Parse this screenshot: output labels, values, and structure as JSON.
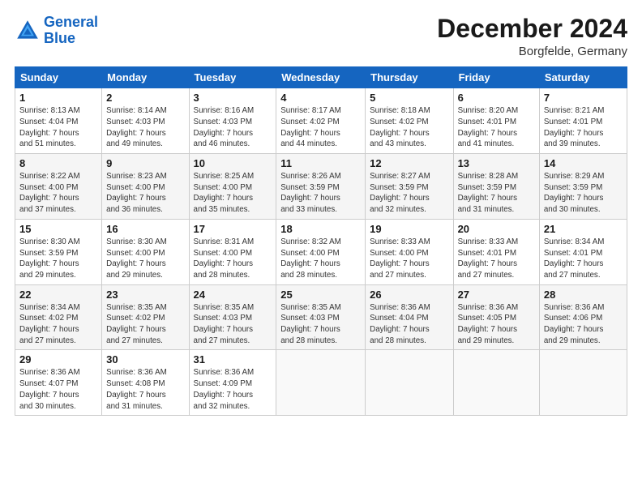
{
  "header": {
    "logo_line1": "General",
    "logo_line2": "Blue",
    "month": "December 2024",
    "location": "Borgfelde, Germany"
  },
  "days_of_week": [
    "Sunday",
    "Monday",
    "Tuesday",
    "Wednesday",
    "Thursday",
    "Friday",
    "Saturday"
  ],
  "weeks": [
    [
      {
        "day": "1",
        "info": "Sunrise: 8:13 AM\nSunset: 4:04 PM\nDaylight: 7 hours\nand 51 minutes."
      },
      {
        "day": "2",
        "info": "Sunrise: 8:14 AM\nSunset: 4:03 PM\nDaylight: 7 hours\nand 49 minutes."
      },
      {
        "day": "3",
        "info": "Sunrise: 8:16 AM\nSunset: 4:03 PM\nDaylight: 7 hours\nand 46 minutes."
      },
      {
        "day": "4",
        "info": "Sunrise: 8:17 AM\nSunset: 4:02 PM\nDaylight: 7 hours\nand 44 minutes."
      },
      {
        "day": "5",
        "info": "Sunrise: 8:18 AM\nSunset: 4:02 PM\nDaylight: 7 hours\nand 43 minutes."
      },
      {
        "day": "6",
        "info": "Sunrise: 8:20 AM\nSunset: 4:01 PM\nDaylight: 7 hours\nand 41 minutes."
      },
      {
        "day": "7",
        "info": "Sunrise: 8:21 AM\nSunset: 4:01 PM\nDaylight: 7 hours\nand 39 minutes."
      }
    ],
    [
      {
        "day": "8",
        "info": "Sunrise: 8:22 AM\nSunset: 4:00 PM\nDaylight: 7 hours\nand 37 minutes."
      },
      {
        "day": "9",
        "info": "Sunrise: 8:23 AM\nSunset: 4:00 PM\nDaylight: 7 hours\nand 36 minutes."
      },
      {
        "day": "10",
        "info": "Sunrise: 8:25 AM\nSunset: 4:00 PM\nDaylight: 7 hours\nand 35 minutes."
      },
      {
        "day": "11",
        "info": "Sunrise: 8:26 AM\nSunset: 3:59 PM\nDaylight: 7 hours\nand 33 minutes."
      },
      {
        "day": "12",
        "info": "Sunrise: 8:27 AM\nSunset: 3:59 PM\nDaylight: 7 hours\nand 32 minutes."
      },
      {
        "day": "13",
        "info": "Sunrise: 8:28 AM\nSunset: 3:59 PM\nDaylight: 7 hours\nand 31 minutes."
      },
      {
        "day": "14",
        "info": "Sunrise: 8:29 AM\nSunset: 3:59 PM\nDaylight: 7 hours\nand 30 minutes."
      }
    ],
    [
      {
        "day": "15",
        "info": "Sunrise: 8:30 AM\nSunset: 3:59 PM\nDaylight: 7 hours\nand 29 minutes."
      },
      {
        "day": "16",
        "info": "Sunrise: 8:30 AM\nSunset: 4:00 PM\nDaylight: 7 hours\nand 29 minutes."
      },
      {
        "day": "17",
        "info": "Sunrise: 8:31 AM\nSunset: 4:00 PM\nDaylight: 7 hours\nand 28 minutes."
      },
      {
        "day": "18",
        "info": "Sunrise: 8:32 AM\nSunset: 4:00 PM\nDaylight: 7 hours\nand 28 minutes."
      },
      {
        "day": "19",
        "info": "Sunrise: 8:33 AM\nSunset: 4:00 PM\nDaylight: 7 hours\nand 27 minutes."
      },
      {
        "day": "20",
        "info": "Sunrise: 8:33 AM\nSunset: 4:01 PM\nDaylight: 7 hours\nand 27 minutes."
      },
      {
        "day": "21",
        "info": "Sunrise: 8:34 AM\nSunset: 4:01 PM\nDaylight: 7 hours\nand 27 minutes."
      }
    ],
    [
      {
        "day": "22",
        "info": "Sunrise: 8:34 AM\nSunset: 4:02 PM\nDaylight: 7 hours\nand 27 minutes."
      },
      {
        "day": "23",
        "info": "Sunrise: 8:35 AM\nSunset: 4:02 PM\nDaylight: 7 hours\nand 27 minutes."
      },
      {
        "day": "24",
        "info": "Sunrise: 8:35 AM\nSunset: 4:03 PM\nDaylight: 7 hours\nand 27 minutes."
      },
      {
        "day": "25",
        "info": "Sunrise: 8:35 AM\nSunset: 4:03 PM\nDaylight: 7 hours\nand 28 minutes."
      },
      {
        "day": "26",
        "info": "Sunrise: 8:36 AM\nSunset: 4:04 PM\nDaylight: 7 hours\nand 28 minutes."
      },
      {
        "day": "27",
        "info": "Sunrise: 8:36 AM\nSunset: 4:05 PM\nDaylight: 7 hours\nand 29 minutes."
      },
      {
        "day": "28",
        "info": "Sunrise: 8:36 AM\nSunset: 4:06 PM\nDaylight: 7 hours\nand 29 minutes."
      }
    ],
    [
      {
        "day": "29",
        "info": "Sunrise: 8:36 AM\nSunset: 4:07 PM\nDaylight: 7 hours\nand 30 minutes."
      },
      {
        "day": "30",
        "info": "Sunrise: 8:36 AM\nSunset: 4:08 PM\nDaylight: 7 hours\nand 31 minutes."
      },
      {
        "day": "31",
        "info": "Sunrise: 8:36 AM\nSunset: 4:09 PM\nDaylight: 7 hours\nand 32 minutes."
      },
      {
        "day": "",
        "info": ""
      },
      {
        "day": "",
        "info": ""
      },
      {
        "day": "",
        "info": ""
      },
      {
        "day": "",
        "info": ""
      }
    ]
  ]
}
